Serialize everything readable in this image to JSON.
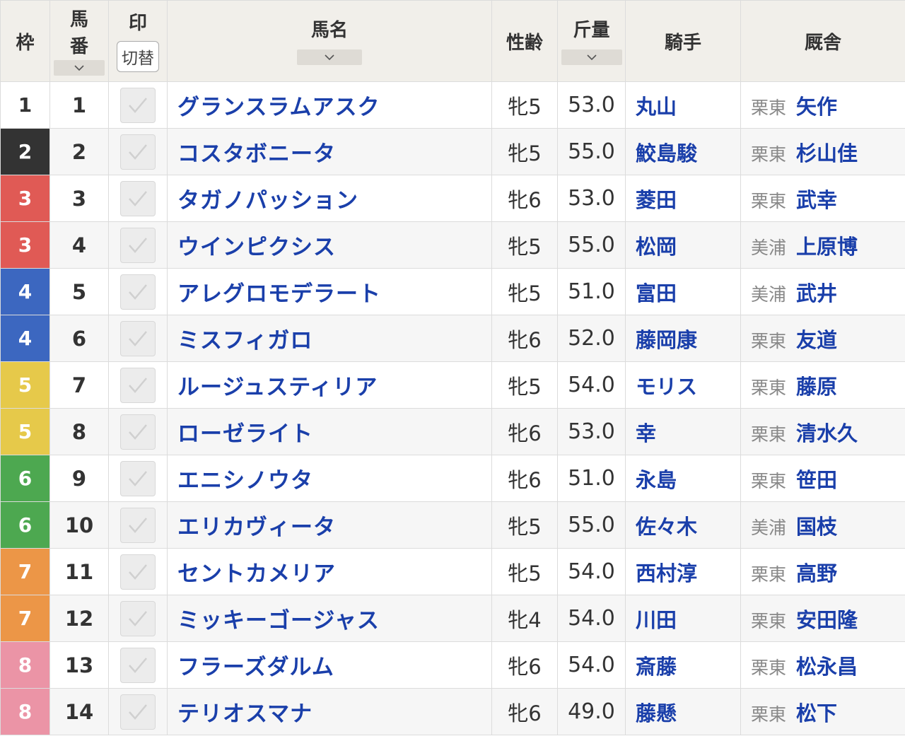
{
  "header": {
    "waku": "枠",
    "umaban_line1": "馬",
    "umaban_line2": "番",
    "mark": "印",
    "switch_label": "切替",
    "horse_name": "馬名",
    "sex_age": "性齢",
    "weight": "斤量",
    "jockey": "騎手",
    "stable": "厩舎",
    "sort_icon": "chevron-down-icon"
  },
  "waku_colors": {
    "1": {
      "bg": "#ffffff",
      "fg": "#333333"
    },
    "2": {
      "bg": "#333333",
      "fg": "#ffffff"
    },
    "3": {
      "bg": "#e05a55",
      "fg": "#ffffff"
    },
    "4": {
      "bg": "#3c67c0",
      "fg": "#ffffff"
    },
    "5": {
      "bg": "#e6c94a",
      "fg": "#ffffff"
    },
    "6": {
      "bg": "#4da850",
      "fg": "#ffffff"
    },
    "7": {
      "bg": "#ec9647",
      "fg": "#ffffff"
    },
    "8": {
      "bg": "#eb94a6",
      "fg": "#ffffff"
    }
  },
  "rows": [
    {
      "waku": "1",
      "umaban": "1",
      "name": "グランスラムアスク",
      "sex_age": "牝5",
      "weight": "53.0",
      "jockey": "丸山",
      "region": "栗東",
      "trainer": "矢作"
    },
    {
      "waku": "2",
      "umaban": "2",
      "name": "コスタボニータ",
      "sex_age": "牝5",
      "weight": "55.0",
      "jockey": "鮫島駿",
      "region": "栗東",
      "trainer": "杉山佳"
    },
    {
      "waku": "3",
      "umaban": "3",
      "name": "タガノパッション",
      "sex_age": "牝6",
      "weight": "53.0",
      "jockey": "菱田",
      "region": "栗東",
      "trainer": "武幸"
    },
    {
      "waku": "3",
      "umaban": "4",
      "name": "ウインピクシス",
      "sex_age": "牝5",
      "weight": "55.0",
      "jockey": "松岡",
      "region": "美浦",
      "trainer": "上原博"
    },
    {
      "waku": "4",
      "umaban": "5",
      "name": "アレグロモデラート",
      "sex_age": "牝5",
      "weight": "51.0",
      "jockey": "富田",
      "region": "美浦",
      "trainer": "武井"
    },
    {
      "waku": "4",
      "umaban": "6",
      "name": "ミスフィガロ",
      "sex_age": "牝6",
      "weight": "52.0",
      "jockey": "藤岡康",
      "region": "栗東",
      "trainer": "友道"
    },
    {
      "waku": "5",
      "umaban": "7",
      "name": "ルージュスティリア",
      "sex_age": "牝5",
      "weight": "54.0",
      "jockey": "モリス",
      "region": "栗東",
      "trainer": "藤原"
    },
    {
      "waku": "5",
      "umaban": "8",
      "name": "ローゼライト",
      "sex_age": "牝6",
      "weight": "53.0",
      "jockey": "幸",
      "region": "栗東",
      "trainer": "清水久"
    },
    {
      "waku": "6",
      "umaban": "9",
      "name": "エニシノウタ",
      "sex_age": "牝6",
      "weight": "51.0",
      "jockey": "永島",
      "region": "栗東",
      "trainer": "笹田"
    },
    {
      "waku": "6",
      "umaban": "10",
      "name": "エリカヴィータ",
      "sex_age": "牝5",
      "weight": "55.0",
      "jockey": "佐々木",
      "region": "美浦",
      "trainer": "国枝"
    },
    {
      "waku": "7",
      "umaban": "11",
      "name": "セントカメリア",
      "sex_age": "牝5",
      "weight": "54.0",
      "jockey": "西村淳",
      "region": "栗東",
      "trainer": "高野"
    },
    {
      "waku": "7",
      "umaban": "12",
      "name": "ミッキーゴージャス",
      "sex_age": "牝4",
      "weight": "54.0",
      "jockey": "川田",
      "region": "栗東",
      "trainer": "安田隆"
    },
    {
      "waku": "8",
      "umaban": "13",
      "name": "フラーズダルム",
      "sex_age": "牝6",
      "weight": "54.0",
      "jockey": "斎藤",
      "region": "栗東",
      "trainer": "松永昌"
    },
    {
      "waku": "8",
      "umaban": "14",
      "name": "テリオスマナ",
      "sex_age": "牝6",
      "weight": "49.0",
      "jockey": "藤懸",
      "region": "栗東",
      "trainer": "松下"
    }
  ]
}
